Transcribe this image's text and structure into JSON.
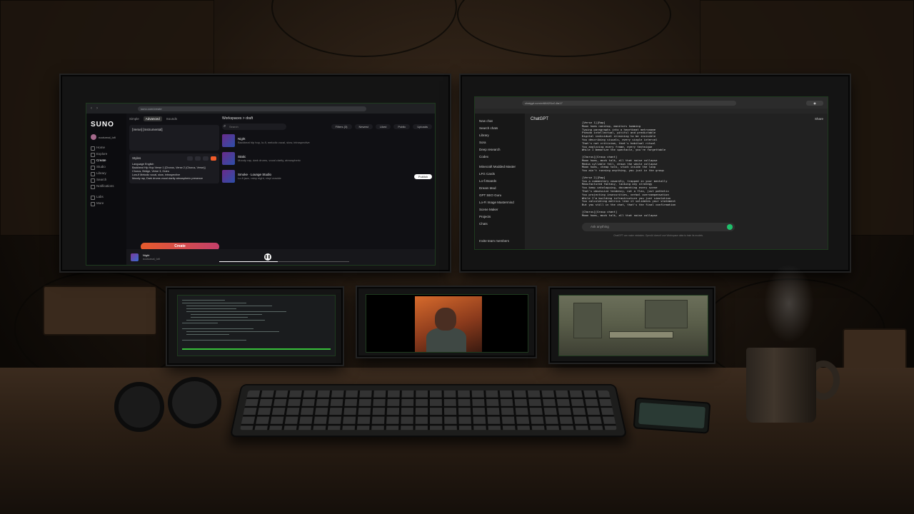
{
  "suno": {
    "url": "suno.com/create",
    "logo": "SUNO",
    "user_name": "nocturnal_lofi",
    "nav": [
      "Home",
      "Explore",
      "Create",
      "Studio",
      "Library",
      "Search",
      "Notifications",
      "Labs",
      "More"
    ],
    "tabs": [
      "Simple",
      "Advanced",
      "Sounds"
    ],
    "lyrics_placeholder": "[Verse] [Instrumental]",
    "styles_label": "Styles",
    "styles_text": "Language English\nBackbeat Hip Hop Verse 1 [Chorus, Verse 2 (Chorus, Verse)]\nChorus, Bridge, Verse 3, Outro\nLow-fi Melodic vocal, slow, introspective\nMoody rap, Dark drums vocal clarity atmospheric presence",
    "create_button": "Create",
    "workspace_title": "Workspaces > draft",
    "search_placeholder": "Search",
    "filters": [
      "Filters (3)",
      "Newest",
      "Liked",
      "Public",
      "Uploads"
    ],
    "songs": [
      {
        "title": "Night",
        "meta": "Backbeat hip hop, lo-fi, melodic vocal, slow, introspective"
      },
      {
        "title": "Static",
        "meta": "Moody rap, dark drums, vocal clarity, atmospheric"
      },
      {
        "title": "Smoke · Lounge Studio",
        "meta": "Lo-fi jazz, rainy night, vinyl crackle"
      }
    ],
    "publish_label": "Publish",
    "player": {
      "title": "Night",
      "artist": "nocturnal_lofi",
      "progress": 0.45
    }
  },
  "chatgpt": {
    "url": "chatgpt.com/c/6842f1c0-8a17",
    "model": "ChatGPT",
    "share": "Share",
    "sidebar": [
      "New chat",
      "Search chats",
      "Library",
      "Sora",
      "GPTs",
      "Deep research",
      "Codex",
      "Minecraft Modded Master",
      "LFG Cards",
      "Lo-fi Boards",
      "Dream Mod",
      "GPT SEO Guru",
      "Lo-Fi Image Mastermind",
      "Scene Maker",
      "Projects",
      "Chats"
    ],
    "invite": "Invite team members",
    "chat_text": "[Verse 1][Rap]\nMoon hums nonstop, monitors humming\nTyping paragraphs into a heartbeat metronome\nPseudo intellectual, pitiful and predictable\nDigital individual straining to be invisible\nYou describing visuals, every single interval\nThat's not criticism, that's habitual ritual\nYou analyzing every frame, every technique\nWhile I memorize the spectacle, you're forgettable\n\n[Chorus][Group chant]\nMoon hums, mock talk, all that noise collapse\nMedia syllable fall, drown the whole collapse\nMoon hums, cheap talk, stuck inside the loop\nYou ain't running anything, you just in the group\n\n[Verse 2][Rap]\nYou a commentary cowardly, trapped in your mentally\nManufactured fantasy, lacking any strategy\nYou keep cataloguing, documenting every scene\nThat's obsessive tendency, not a flex, just pathetic\nYou projecting insecurities, verbal overcompensation\nWhile I'm building infrastructure you just simulation\nYou calculating metrics like it validates your statement\nBut you still in the chat, that's the final confirmation\n\n[Chorus][Group chant]\nMoon hums, mock talk, all that noise collapse",
    "input_placeholder": "Ask anything",
    "footer": "ChatGPT can make mistakes. OpenAI doesn't use Workspace data to train its models."
  },
  "colors": {
    "accent_orange": "#f25c2a",
    "send_green": "#1fbf6b",
    "terminal_green": "#38c03a"
  }
}
